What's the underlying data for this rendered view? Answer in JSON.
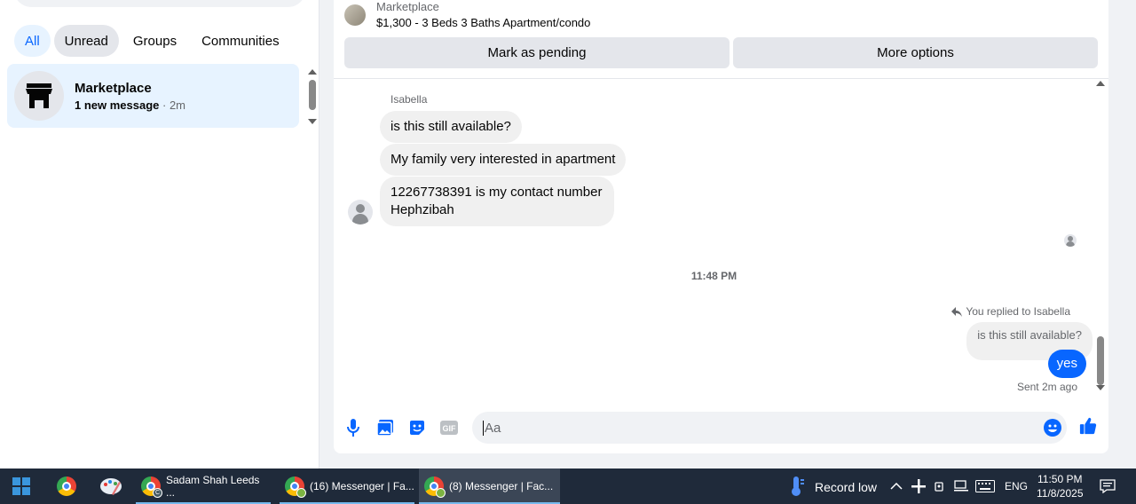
{
  "filters": [
    {
      "label": "All"
    },
    {
      "label": "Unread"
    },
    {
      "label": "Groups"
    },
    {
      "label": "Communities"
    }
  ],
  "conversation": {
    "name": "Marketplace",
    "new_message": "1 new message",
    "time": " · 2m"
  },
  "listing": {
    "label": "Marketplace",
    "title": "$1,300 - 3 Beds 3 Baths Apartment/condo"
  },
  "actions": {
    "pending": "Mark as pending",
    "more": "More options"
  },
  "messages": {
    "sender": "Isabella",
    "incoming": [
      "is this still available?",
      "My family very interested in apartment",
      "12267738391 is my contact number Hephzibah"
    ],
    "timestamp": "11:48 PM",
    "replied_label": "You replied to Isabella",
    "quoted": "is this still available?",
    "outgoing": "yes",
    "sent_status": "Sent 2m ago"
  },
  "composer": {
    "placeholder": "Aa"
  },
  "taskbar": {
    "apps": [
      {
        "label": "Sadam Shah Leeds ..."
      },
      {
        "label": "(16) Messenger | Fa..."
      },
      {
        "label": "(8) Messenger | Fac..."
      }
    ],
    "weather": "Record low",
    "language": "ENG",
    "time": "11:50 PM",
    "date": "11/8/2025"
  },
  "colors": {
    "accent": "#0866ff",
    "chip_active_bg": "#e7f3ff",
    "taskbar_bg": "#1f2a3a"
  },
  "icons": [
    "storefront-icon",
    "microphone-icon",
    "photo-icon",
    "sticker-icon",
    "gif-icon",
    "emoji-icon",
    "thumbs-up-icon",
    "reply-icon",
    "windows-start-icon",
    "chrome-icon",
    "thermometer-icon",
    "chevron-up-icon",
    "notification-icon"
  ]
}
